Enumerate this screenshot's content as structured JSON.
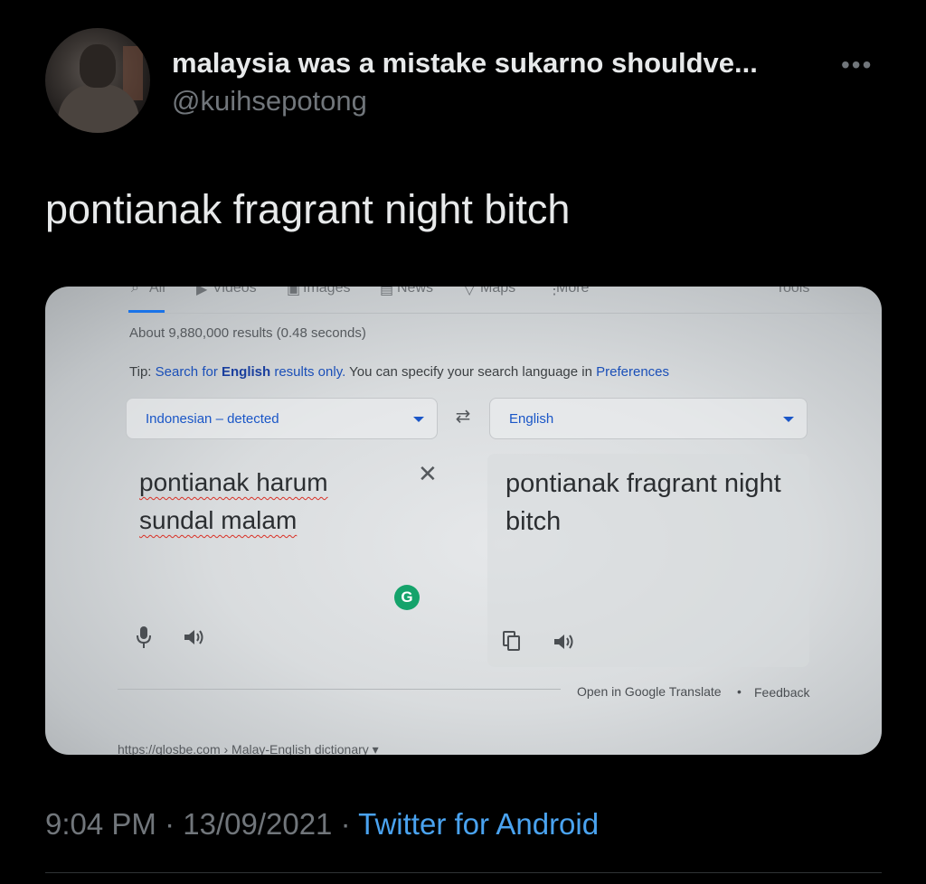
{
  "tweet": {
    "display_name": "malaysia was a mistake sukarno shouldve...",
    "handle": "@kuihsepotong",
    "more_icon": "more-horizontal-icon",
    "text": "pontianak fragrant night bitch",
    "time": "9:04 PM",
    "sep1": " · ",
    "date": "13/09/2021",
    "sep2": " · ",
    "source": "Twitter for Android",
    "colors": {
      "background": "#000000",
      "text": "#e7e9ea",
      "muted": "#71767b",
      "link": "#4aa3f0"
    }
  },
  "screenshot": {
    "tabs": [
      "All",
      "Videos",
      "Images",
      "News",
      "Maps",
      "More",
      "Tools"
    ],
    "result_stats": "About 9,880,000 results (0.48 seconds)",
    "tip": {
      "prefix": "Tip: ",
      "search_for": "Search for ",
      "lang": "English",
      "results_only": " results only.",
      "middle": " You can specify your search language in ",
      "preferences": "Preferences"
    },
    "source_language": "Indonesian – detected",
    "target_language": "English",
    "source_text_line1": "pontianak harum",
    "source_text_line2": "sundal malam",
    "translated_text": "pontianak fragrant night bitch",
    "grammarly_letter": "G",
    "open_in_translate": "Open in Google Translate",
    "dot": "•",
    "feedback": "Feedback",
    "next_result": "https://glosbe.com › Malay-English dictionary ▾",
    "accent_color": "#1a73e8"
  }
}
